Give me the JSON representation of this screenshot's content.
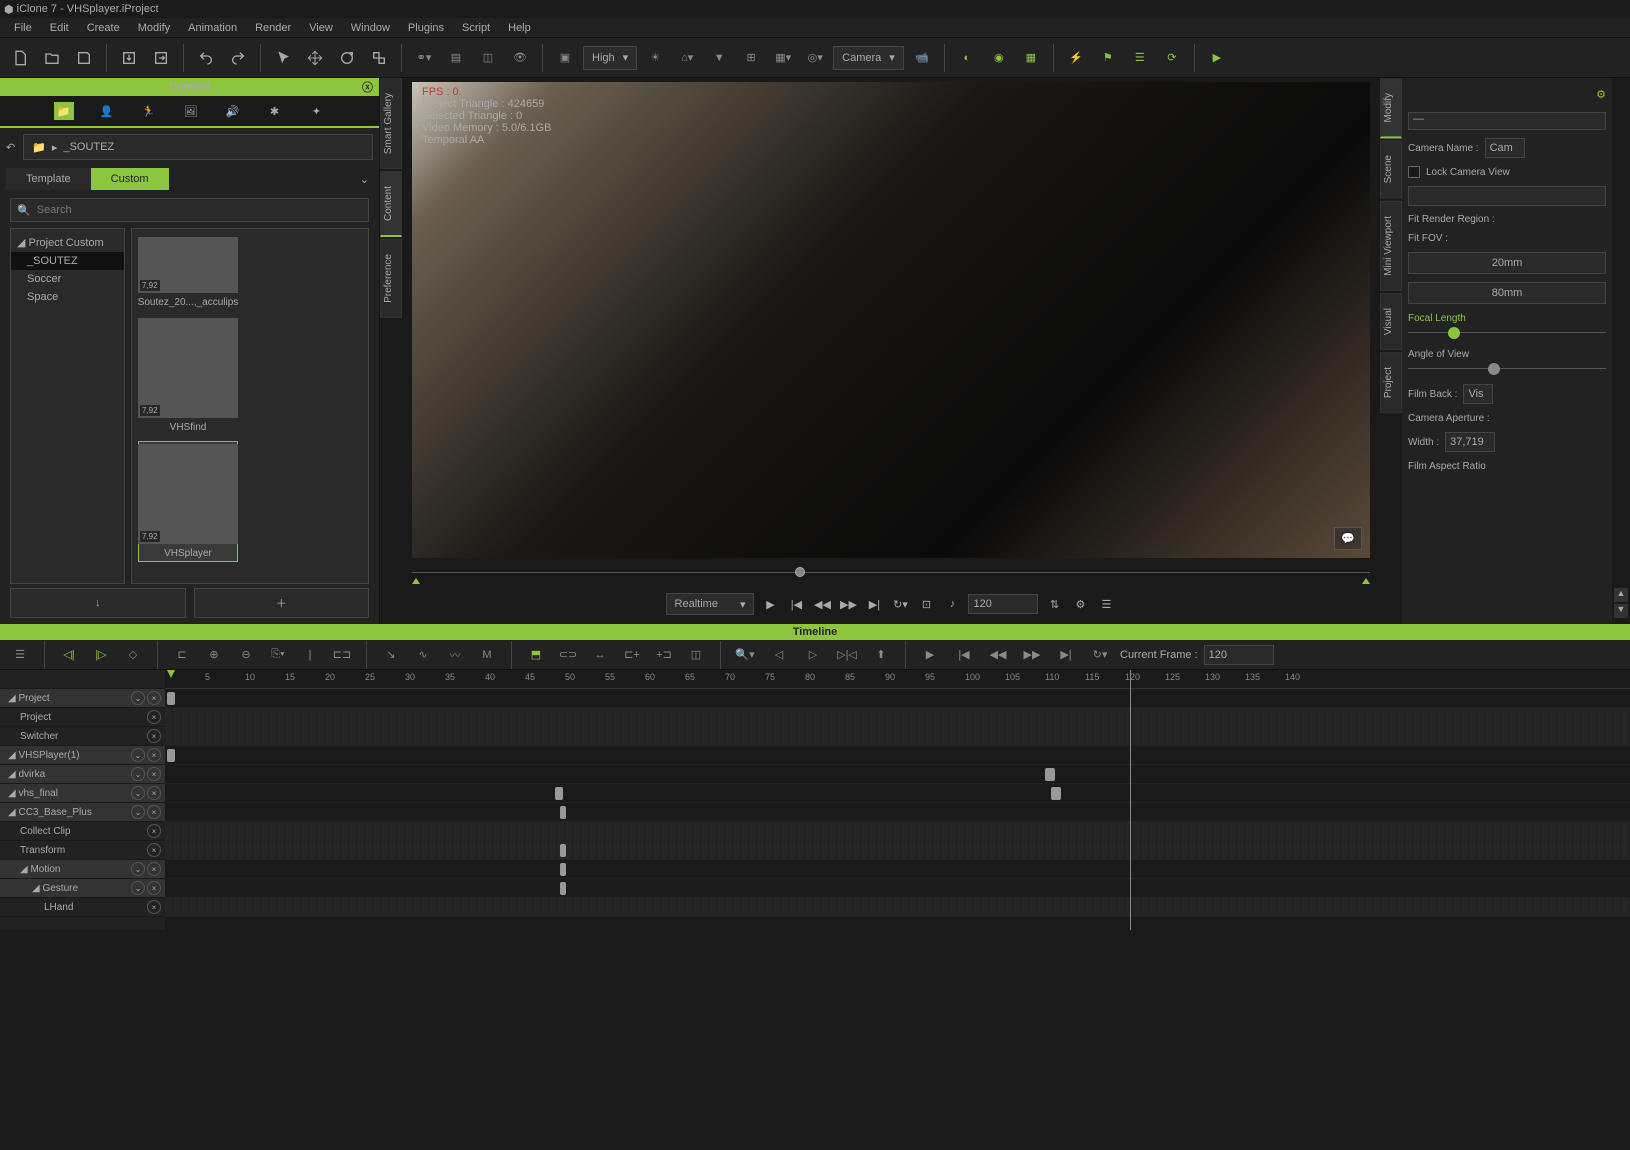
{
  "title": "iClone 7 - VHSplayer.iProject",
  "menubar": [
    "File",
    "Edit",
    "Create",
    "Modify",
    "Animation",
    "Render",
    "View",
    "Window",
    "Plugins",
    "Script",
    "Help"
  ],
  "quality": "High",
  "camera": "Camera",
  "content": {
    "title": "Content",
    "breadcrumb": "_SOUTEZ",
    "tab_template": "Template",
    "tab_custom": "Custom",
    "search_placeholder": "Search",
    "tree_root": "Project Custom",
    "tree_items": [
      "_SOUTEZ",
      "Soccer",
      "Space"
    ],
    "thumbs": [
      {
        "label": "Soutez_20...,_acculips",
        "tall": false
      },
      {
        "label": "VHSfind",
        "tall": true
      },
      {
        "label": "VHSplayer",
        "tall": true,
        "selected": true
      }
    ]
  },
  "side_left": [
    "Smart Gallery",
    "Content",
    "Preference"
  ],
  "viewport": {
    "fps": "FPS : 0.",
    "tri": "Project Triangle : 424659",
    "sel_tri": "Selected Triangle : 0",
    "vmem": "Video Memory : 5.0/6.1GB",
    "aa": "Temporal AA"
  },
  "playbar": {
    "mode": "Realtime",
    "frame": "120"
  },
  "side_right": [
    "Modify",
    "Scene",
    "Mini Viewport",
    "Visual",
    "Project"
  ],
  "camera_panel": {
    "name_label": "Camera Name :",
    "name": "Cam",
    "lock": "Lock Camera View",
    "fit_render": "Fit Render Region :",
    "fit_fov": "Fit FOV :",
    "btn_20": "20mm",
    "btn_80": "80mm",
    "focal": "Focal Length",
    "angle": "Angle of View",
    "filmback": "Film Back :",
    "filmback_val": "Vis",
    "aperture": "Camera Aperture :",
    "width_label": "Width :",
    "width": "37,719",
    "aspect": "Film Aspect Ratio"
  },
  "timeline": {
    "title": "Timeline",
    "current_frame_label": "Current Frame :",
    "current_frame": "120",
    "ruler": [
      5,
      10,
      15,
      20,
      25,
      30,
      35,
      40,
      45,
      50,
      55,
      60,
      65,
      70,
      75,
      80,
      85,
      90,
      95,
      100,
      105,
      110,
      115,
      120,
      125,
      130,
      135,
      140
    ],
    "tracks": [
      {
        "label": "Project",
        "indent": 0,
        "head": true,
        "expandable": true
      },
      {
        "label": "Project",
        "indent": 1
      },
      {
        "label": "Switcher",
        "indent": 1
      },
      {
        "label": "VHSPlayer(1)",
        "indent": 0,
        "head": true,
        "expandable": true
      },
      {
        "label": "dvirka",
        "indent": 0,
        "head": true,
        "expandable": true
      },
      {
        "label": "vhs_final",
        "indent": 0,
        "head": true,
        "expandable": true
      },
      {
        "label": "CC3_Base_Plus",
        "indent": 0,
        "head": true,
        "expandable": true
      },
      {
        "label": "Collect Clip",
        "indent": 1
      },
      {
        "label": "Transform",
        "indent": 1
      },
      {
        "label": "Motion",
        "indent": 1,
        "head": true,
        "expandable": true
      },
      {
        "label": "Gesture",
        "indent": 2,
        "head": true,
        "expandable": true
      },
      {
        "label": "LHand",
        "indent": 3
      }
    ]
  }
}
